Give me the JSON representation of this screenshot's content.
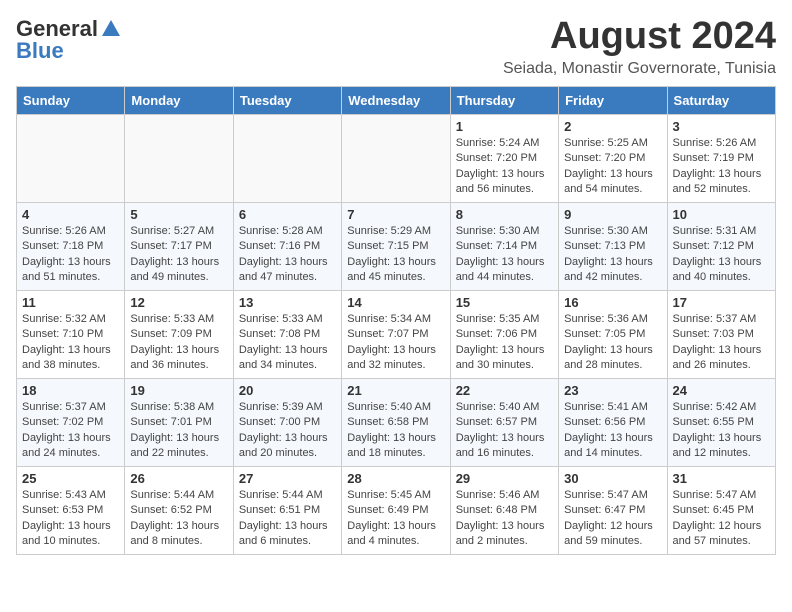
{
  "logo": {
    "general": "General",
    "blue": "Blue"
  },
  "title": {
    "month": "August 2024",
    "location": "Seiada, Monastir Governorate, Tunisia"
  },
  "weekdays": [
    "Sunday",
    "Monday",
    "Tuesday",
    "Wednesday",
    "Thursday",
    "Friday",
    "Saturday"
  ],
  "weeks": [
    [
      {
        "day": null
      },
      {
        "day": null
      },
      {
        "day": null
      },
      {
        "day": null
      },
      {
        "day": 1,
        "sunrise": "5:24 AM",
        "sunset": "7:20 PM",
        "daylight": "13 hours and 56 minutes."
      },
      {
        "day": 2,
        "sunrise": "5:25 AM",
        "sunset": "7:20 PM",
        "daylight": "13 hours and 54 minutes."
      },
      {
        "day": 3,
        "sunrise": "5:26 AM",
        "sunset": "7:19 PM",
        "daylight": "13 hours and 52 minutes."
      }
    ],
    [
      {
        "day": 4,
        "sunrise": "5:26 AM",
        "sunset": "7:18 PM",
        "daylight": "13 hours and 51 minutes."
      },
      {
        "day": 5,
        "sunrise": "5:27 AM",
        "sunset": "7:17 PM",
        "daylight": "13 hours and 49 minutes."
      },
      {
        "day": 6,
        "sunrise": "5:28 AM",
        "sunset": "7:16 PM",
        "daylight": "13 hours and 47 minutes."
      },
      {
        "day": 7,
        "sunrise": "5:29 AM",
        "sunset": "7:15 PM",
        "daylight": "13 hours and 45 minutes."
      },
      {
        "day": 8,
        "sunrise": "5:30 AM",
        "sunset": "7:14 PM",
        "daylight": "13 hours and 44 minutes."
      },
      {
        "day": 9,
        "sunrise": "5:30 AM",
        "sunset": "7:13 PM",
        "daylight": "13 hours and 42 minutes."
      },
      {
        "day": 10,
        "sunrise": "5:31 AM",
        "sunset": "7:12 PM",
        "daylight": "13 hours and 40 minutes."
      }
    ],
    [
      {
        "day": 11,
        "sunrise": "5:32 AM",
        "sunset": "7:10 PM",
        "daylight": "13 hours and 38 minutes."
      },
      {
        "day": 12,
        "sunrise": "5:33 AM",
        "sunset": "7:09 PM",
        "daylight": "13 hours and 36 minutes."
      },
      {
        "day": 13,
        "sunrise": "5:33 AM",
        "sunset": "7:08 PM",
        "daylight": "13 hours and 34 minutes."
      },
      {
        "day": 14,
        "sunrise": "5:34 AM",
        "sunset": "7:07 PM",
        "daylight": "13 hours and 32 minutes."
      },
      {
        "day": 15,
        "sunrise": "5:35 AM",
        "sunset": "7:06 PM",
        "daylight": "13 hours and 30 minutes."
      },
      {
        "day": 16,
        "sunrise": "5:36 AM",
        "sunset": "7:05 PM",
        "daylight": "13 hours and 28 minutes."
      },
      {
        "day": 17,
        "sunrise": "5:37 AM",
        "sunset": "7:03 PM",
        "daylight": "13 hours and 26 minutes."
      }
    ],
    [
      {
        "day": 18,
        "sunrise": "5:37 AM",
        "sunset": "7:02 PM",
        "daylight": "13 hours and 24 minutes."
      },
      {
        "day": 19,
        "sunrise": "5:38 AM",
        "sunset": "7:01 PM",
        "daylight": "13 hours and 22 minutes."
      },
      {
        "day": 20,
        "sunrise": "5:39 AM",
        "sunset": "7:00 PM",
        "daylight": "13 hours and 20 minutes."
      },
      {
        "day": 21,
        "sunrise": "5:40 AM",
        "sunset": "6:58 PM",
        "daylight": "13 hours and 18 minutes."
      },
      {
        "day": 22,
        "sunrise": "5:40 AM",
        "sunset": "6:57 PM",
        "daylight": "13 hours and 16 minutes."
      },
      {
        "day": 23,
        "sunrise": "5:41 AM",
        "sunset": "6:56 PM",
        "daylight": "13 hours and 14 minutes."
      },
      {
        "day": 24,
        "sunrise": "5:42 AM",
        "sunset": "6:55 PM",
        "daylight": "13 hours and 12 minutes."
      }
    ],
    [
      {
        "day": 25,
        "sunrise": "5:43 AM",
        "sunset": "6:53 PM",
        "daylight": "13 hours and 10 minutes."
      },
      {
        "day": 26,
        "sunrise": "5:44 AM",
        "sunset": "6:52 PM",
        "daylight": "13 hours and 8 minutes."
      },
      {
        "day": 27,
        "sunrise": "5:44 AM",
        "sunset": "6:51 PM",
        "daylight": "13 hours and 6 minutes."
      },
      {
        "day": 28,
        "sunrise": "5:45 AM",
        "sunset": "6:49 PM",
        "daylight": "13 hours and 4 minutes."
      },
      {
        "day": 29,
        "sunrise": "5:46 AM",
        "sunset": "6:48 PM",
        "daylight": "13 hours and 2 minutes."
      },
      {
        "day": 30,
        "sunrise": "5:47 AM",
        "sunset": "6:47 PM",
        "daylight": "12 hours and 59 minutes."
      },
      {
        "day": 31,
        "sunrise": "5:47 AM",
        "sunset": "6:45 PM",
        "daylight": "12 hours and 57 minutes."
      }
    ]
  ],
  "labels": {
    "sunrise": "Sunrise:",
    "sunset": "Sunset:",
    "daylight": "Daylight:"
  }
}
